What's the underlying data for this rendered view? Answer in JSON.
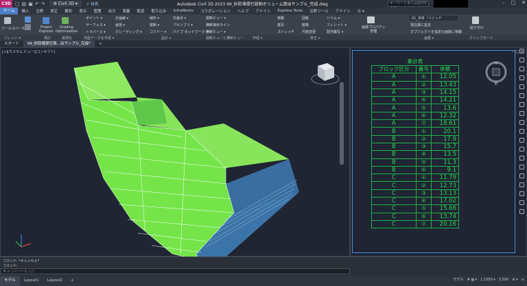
{
  "title_bar": {
    "logo": "C3D",
    "workspace": "Civil 3D",
    "share_label": "共有",
    "document_title": "Autodesk Civil 3D 2023    99_砂防堰堤打設割ボリューム算出サンプル_完成.dwg",
    "search_placeholder": "キーワードまたは語句を入力",
    "window_controls": [
      "–",
      "□",
      "✕"
    ]
  },
  "menu_tabs": [
    "ホーム",
    "挿入",
    "注釈",
    "修正",
    "解析",
    "表示",
    "管理",
    "出力",
    "測量",
    "軌道",
    "取り込み",
    "InfraWorks",
    "コラボレーション",
    "ヘルプ",
    "アドイン",
    "Express Tools",
    "注釈ツール",
    "アドイン",
    "Ⓐ ▾"
  ],
  "active_menu_tab": "ホーム",
  "ribbon": {
    "tool_space": "ツールスペース",
    "project_explorer": "Project\nExplorer",
    "grading_opt": "Grading\nOptimization",
    "points": "ポイント ▾",
    "surfaces": "サーフェス ▾",
    "traverse": "トラバース ▾",
    "feature_line": "計画線 ▾",
    "grading": "グレーディング ▾",
    "parcel": "画地 ▾",
    "alignment": "線形 ▾",
    "profile": "縦断 ▾",
    "corridor": "コリドー ▾",
    "intersection": "交差点 ▾",
    "assembly": "アセンブリ ▾",
    "pipe_network": "パイプ ネットワーク ▾",
    "profile_view": "縦断ビュー ▾",
    "sample_lines": "横断抽出ライン",
    "section_views": "横断ビュー ▾",
    "move": "移動",
    "rotate": "回転",
    "trim": "トリム ▾",
    "copy": "複写",
    "mirror": "鏡像",
    "fillet": "フィレット ▾",
    "stretch": "ストレッチ",
    "scale": "尺度変更",
    "array": "配列複写 ▾",
    "layer_props": "画層プロパティ\n管理",
    "layer_name": "01_本体（リジッド",
    "layer_current": "現在層に設定",
    "layer_match": "オブジェクトを指定の画層に移動",
    "paste": "貼り付け"
  },
  "panel_labels": [
    "パレット ▾",
    "検討",
    "最適化",
    "地盤データを作成 ▾",
    "設計 ▾",
    "縦断ビューと横断ビュー",
    "作成 ▾",
    "修正 ▾",
    "画層 ▾",
    "クリップボード"
  ],
  "doc_tabs": [
    "スタート",
    "99_砂防堰堤打設...出サンプル_完成*",
    "+"
  ],
  "viewport_label": "[+][カスタム ビュー][コンセプト]",
  "navcube_label": "前",
  "compass_label": "N",
  "table": {
    "title": "集計表",
    "headers": [
      "ブロック区分",
      "番号",
      "体積"
    ],
    "rows": [
      [
        "A",
        "①",
        "12.05"
      ],
      [
        "A",
        "②",
        "13.43"
      ],
      [
        "A",
        "③",
        "14.15"
      ],
      [
        "A",
        "④",
        "14.21"
      ],
      [
        "A",
        "⑤",
        "13.6"
      ],
      [
        "A",
        "⑥",
        "12.32"
      ],
      [
        "A",
        "⑦",
        "18.61"
      ],
      [
        "B",
        "①",
        "20.1"
      ],
      [
        "B",
        "②",
        "17.9"
      ],
      [
        "B",
        "③",
        "15.7"
      ],
      [
        "B",
        "④",
        "13.5"
      ],
      [
        "B",
        "⑤",
        "11.3"
      ],
      [
        "B",
        "⑥",
        "9.1"
      ],
      [
        "C",
        "①",
        "11.79"
      ],
      [
        "C",
        "②",
        "12.73"
      ],
      [
        "C",
        "③",
        "13.13"
      ],
      [
        "C",
        "④",
        "17.02"
      ],
      [
        "C",
        "⑤",
        "15.66"
      ],
      [
        "C",
        "⑥",
        "13.74"
      ],
      [
        "C",
        "⑦",
        "20.16"
      ]
    ]
  },
  "command": {
    "line1": "コマンド: *キャンセル*",
    "line2": "コマンド:",
    "placeholder": "コマンドを入力"
  },
  "status": {
    "tabs": [
      "モデル",
      "Layout1",
      "Layout2",
      "+"
    ],
    "active": "モデル",
    "right_items": [
      "モデル",
      "# ▦ ▾",
      "1:1000 ▾",
      "3.500",
      "⚙ ▾",
      "≡"
    ]
  },
  "colors": {
    "solid_top": "#8ee860",
    "solid_front": "#75e448",
    "solid_side": "#3b74a8",
    "table_green": "#2bd84e",
    "accent": "#4c7fc7"
  }
}
